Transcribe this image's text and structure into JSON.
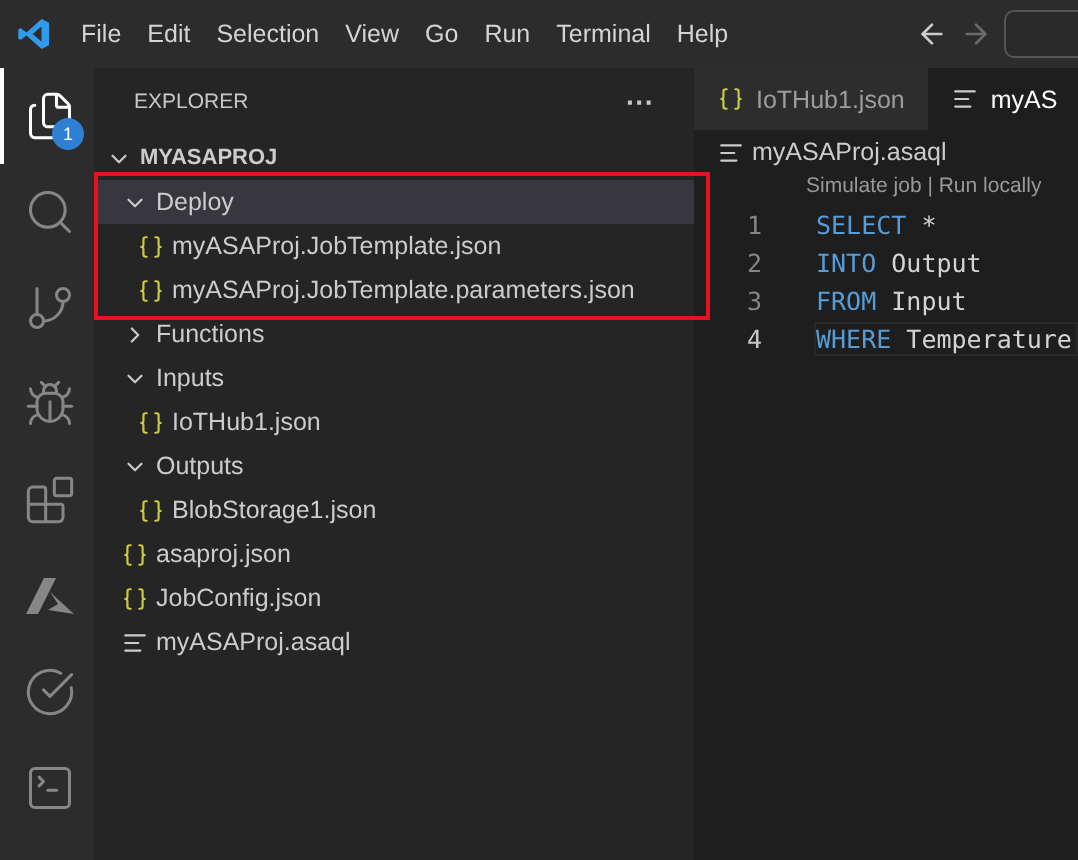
{
  "menu": [
    "File",
    "Edit",
    "Selection",
    "View",
    "Go",
    "Run",
    "Terminal",
    "Help"
  ],
  "activity_bar": [
    {
      "kind": "explorer",
      "selected": true,
      "badge": "1"
    },
    {
      "kind": "search",
      "selected": false
    },
    {
      "kind": "source-control",
      "selected": false
    },
    {
      "kind": "run-debug",
      "selected": false
    },
    {
      "kind": "extensions",
      "selected": false
    },
    {
      "kind": "azure",
      "selected": false
    },
    {
      "kind": "testing",
      "selected": false
    },
    {
      "kind": "terminal",
      "selected": false
    }
  ],
  "sidebar": {
    "title": "EXPLORER",
    "more": "···",
    "tree": [
      {
        "kind": "folder",
        "label": "MYASAPROJ",
        "expanded": true,
        "selected": false,
        "children": [
          {
            "kind": "folder",
            "label": "Deploy",
            "expanded": true,
            "selected": true,
            "children": [
              {
                "kind": "json",
                "label": "myASAProj.JobTemplate.json",
                "selected": false
              },
              {
                "kind": "json",
                "label": "myASAProj.JobTemplate.parameters.json",
                "selected": false
              }
            ]
          },
          {
            "kind": "folder",
            "label": "Functions",
            "expanded": false,
            "selected": false
          },
          {
            "kind": "folder",
            "label": "Inputs",
            "expanded": true,
            "selected": false,
            "children": [
              {
                "kind": "json",
                "label": "IoTHub1.json",
                "selected": false
              }
            ]
          },
          {
            "kind": "folder",
            "label": "Outputs",
            "expanded": true,
            "selected": false,
            "children": [
              {
                "kind": "json",
                "label": "BlobStorage1.json",
                "selected": false
              }
            ]
          },
          {
            "kind": "json",
            "label": "asaproj.json",
            "selected": false
          },
          {
            "kind": "json",
            "label": "JobConfig.json",
            "selected": false
          },
          {
            "kind": "query",
            "label": "myASAProj.asaql",
            "selected": false
          }
        ]
      }
    ]
  },
  "tabs": [
    {
      "kind": "json",
      "label": "IoTHub1.json",
      "selected": false
    },
    {
      "kind": "query",
      "label": "myAS",
      "selected": true
    }
  ],
  "breadcrumb": "myASAProj.asaql",
  "codelens": "Simulate job | Run locally",
  "code": [
    {
      "number": "1",
      "current": false,
      "tokens": [
        {
          "kind": "keyword",
          "text": "SELECT"
        },
        {
          "kind": "plain",
          "text": "*"
        }
      ]
    },
    {
      "number": "2",
      "current": false,
      "tokens": [
        {
          "kind": "keyword",
          "text": "INTO"
        },
        {
          "kind": "plain",
          "text": "Output"
        }
      ]
    },
    {
      "number": "3",
      "current": false,
      "tokens": [
        {
          "kind": "keyword",
          "text": "FROM"
        },
        {
          "kind": "plain",
          "text": "Input"
        }
      ]
    },
    {
      "number": "4",
      "current": true,
      "tokens": [
        {
          "kind": "keyword",
          "text": "WHERE"
        },
        {
          "kind": "plain",
          "text": "Temperature"
        }
      ]
    }
  ]
}
